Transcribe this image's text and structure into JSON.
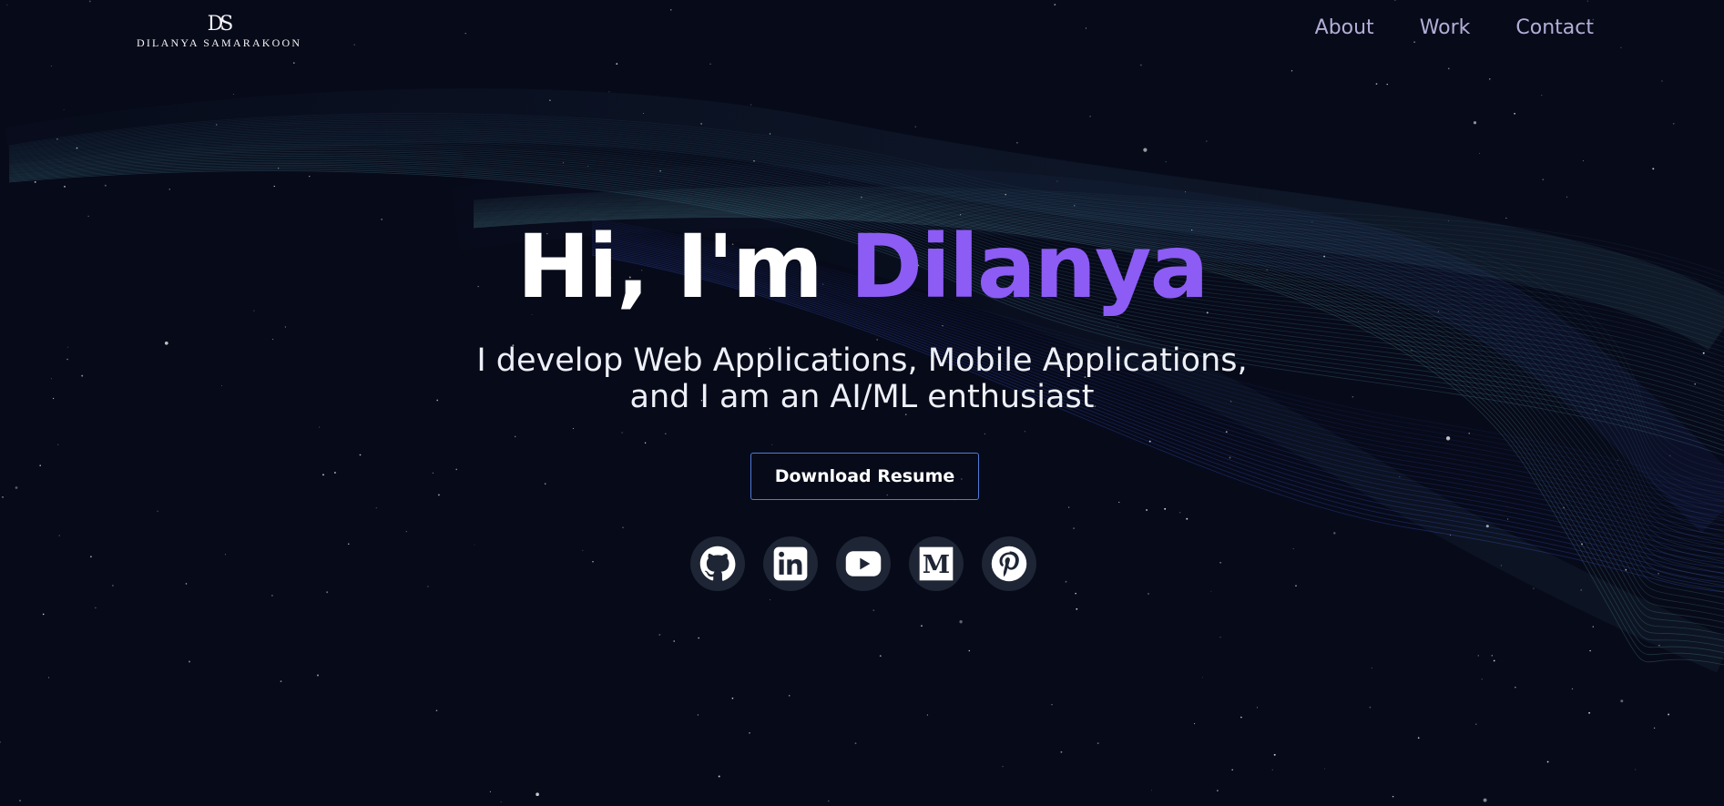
{
  "header": {
    "logo_mark": "DS",
    "logo_text": "DILANYA SAMARAKOON",
    "nav": [
      {
        "label": "About"
      },
      {
        "label": "Work"
      },
      {
        "label": "Contact"
      }
    ]
  },
  "hero": {
    "greeting": "Hi, I'm ",
    "name": "Dilanya",
    "subtitle_line1": "I develop Web Applications, Mobile Applications,",
    "subtitle_line2": "and I am an AI/ML enthusiast",
    "cta_label": "Download Resume"
  },
  "socials": [
    {
      "icon": "github-icon"
    },
    {
      "icon": "linkedin-icon"
    },
    {
      "icon": "youtube-icon"
    },
    {
      "icon": "medium-icon"
    },
    {
      "icon": "pinterest-icon"
    }
  ],
  "colors": {
    "background": "#070a19",
    "accent": "#8c5cf5",
    "nav_text": "#b3aed6",
    "button_border": "#4f7bd8",
    "social_bg": "#1e2535"
  }
}
